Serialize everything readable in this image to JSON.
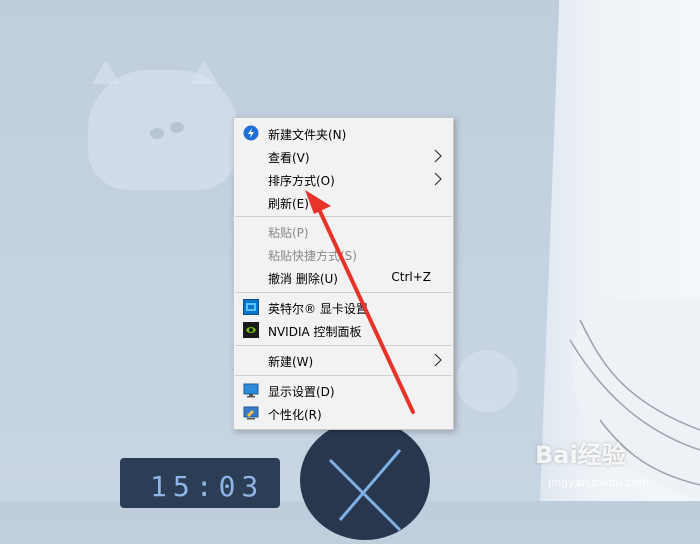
{
  "context_menu": {
    "items": [
      {
        "label": "新建文件夹(N)",
        "icon": "new-folder-icon"
      },
      {
        "label": "查看(V)",
        "submenu": true
      },
      {
        "label": "排序方式(O)",
        "submenu": true
      },
      {
        "label": "刷新(E)"
      },
      {
        "label": "粘贴(P)",
        "disabled": true
      },
      {
        "label": "粘贴快捷方式(S)",
        "disabled": true
      },
      {
        "label": "撤消 删除(U)",
        "shortcut": "Ctrl+Z"
      },
      {
        "label": "英特尔® 显卡设置",
        "icon": "intel-graphics-icon"
      },
      {
        "label": "NVIDIA 控制面板",
        "icon": "nvidia-icon"
      },
      {
        "label": "新建(W)",
        "submenu": true
      },
      {
        "label": "显示设置(D)",
        "icon": "display-settings-icon"
      },
      {
        "label": "个性化(R)",
        "icon": "personalize-icon"
      }
    ]
  },
  "wallpaper": {
    "calendar_text": "15:03"
  },
  "watermark": {
    "brand": "Bai经验",
    "url": "jingyan.baidu.com"
  },
  "colors": {
    "menu_bg": "#f2f2f2",
    "annotation_arrow": "#e8332a",
    "disabled_text": "#8a8a8a"
  }
}
